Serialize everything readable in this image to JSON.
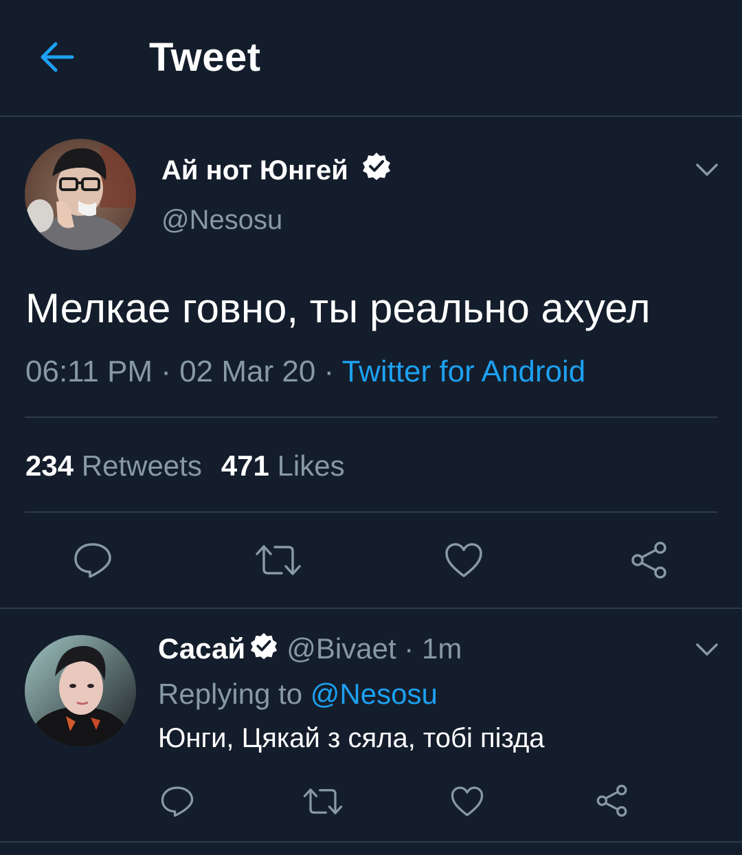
{
  "header": {
    "title": "Tweet"
  },
  "tweet": {
    "author_name": "Ай нот Юнгей",
    "author_handle": "@Nesosu",
    "text": "Мелкае говно, ты реально ахуел",
    "time": "06:11 PM",
    "date": "02 Mar 20",
    "source": "Twitter for Android",
    "retweets_count": "234",
    "retweets_label": "Retweets",
    "likes_count": "471",
    "likes_label": "Likes"
  },
  "reply": {
    "author_name": "Сасай",
    "author_handle": "@Bivaet",
    "time_ago": "1m",
    "replying_to_label": "Replying to",
    "replying_to_handle": "@Nesosu",
    "text": "Юнги, Цякай з сяла, тобі пізда"
  },
  "colors": {
    "background": "#141d2b",
    "accent": "#1da1f2",
    "secondary_text": "#8899a6",
    "divider": "#2f3b4b"
  },
  "icons": {
    "back": "arrow-left-icon",
    "verified": "verified-badge-icon",
    "more": "chevron-down-icon",
    "reply": "comment-icon",
    "retweet": "retweet-icon",
    "like": "heart-icon",
    "share": "share-icon"
  }
}
